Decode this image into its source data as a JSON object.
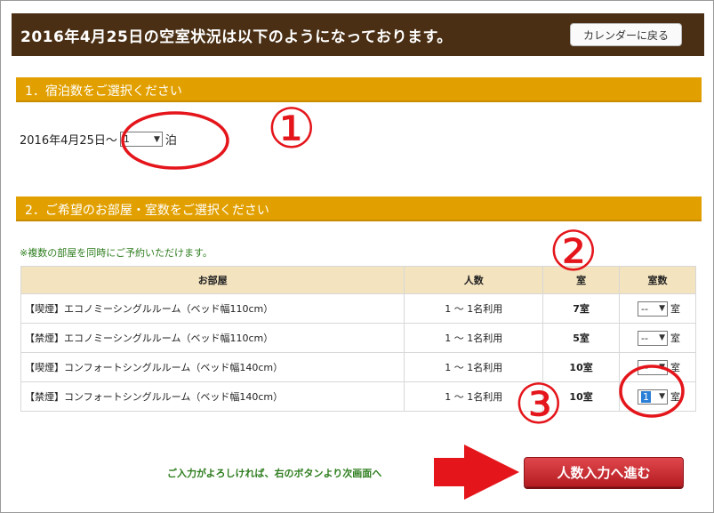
{
  "header": {
    "title": "2016年4月25日の空室状況は以下のようになっております。",
    "calendar_button": "カレンダーに戻る"
  },
  "section1": {
    "heading": "1．宿泊数をご選択ください",
    "date_label": "2016年4月25日",
    "tilde": "～",
    "nights_value": "1",
    "nights_suffix": "泊"
  },
  "section2": {
    "heading": "2．ご希望のお部屋・室数をご選択ください",
    "note": "※複数の部屋を同時にご予約いただけます。",
    "columns": [
      "お部屋",
      "人数",
      "室",
      "室数"
    ],
    "rows": [
      {
        "room": "【喫煙】エコノミーシングルルーム（ベッド幅110cm）",
        "people": "1 ～ 1名利用",
        "vacancy": "7室",
        "count": "--",
        "unit": "室"
      },
      {
        "room": "【禁煙】エコノミーシングルルーム（ベッド幅110cm）",
        "people": "1 ～ 1名利用",
        "vacancy": "5室",
        "count": "--",
        "unit": "室"
      },
      {
        "room": "【喫煙】コンフォートシングルルーム（ベッド幅140cm）",
        "people": "1 ～ 1名利用",
        "vacancy": "10室",
        "count": "--",
        "unit": "室"
      },
      {
        "room": "【禁煙】コンフォートシングルルーム（ベッド幅140cm）",
        "people": "1 ～ 1名利用",
        "vacancy": "10室",
        "count": "1",
        "unit": "室"
      }
    ]
  },
  "footer": {
    "prompt": "ご入力がよろしければ、右のボタンより次画面へ",
    "next_button": "人数入力へ進む"
  },
  "annotations": {
    "step1": "①",
    "step2": "②",
    "step3": "③"
  },
  "colors": {
    "header_bg": "#4a2f14",
    "section_bg": "#e2a000",
    "table_header_bg": "#f3e3bf",
    "note_text": "#2e7d1e",
    "button_red": "#c62a30",
    "annotation_red": "#e4151b"
  }
}
